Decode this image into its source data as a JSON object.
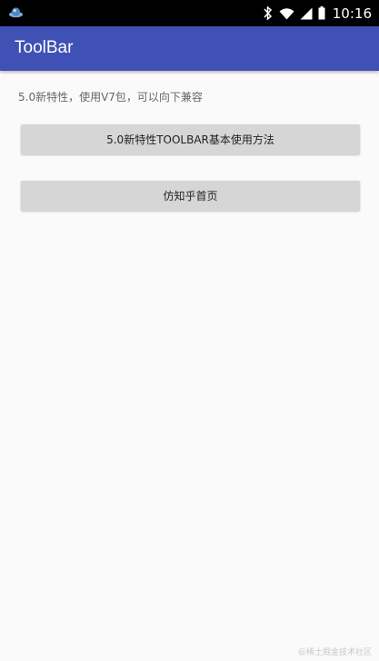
{
  "status_bar": {
    "time": "10:16",
    "icons": [
      "app-notification-icon",
      "bluetooth-icon",
      "wifi-icon",
      "signal-icon",
      "battery-icon"
    ]
  },
  "toolbar": {
    "title": "ToolBar",
    "color": "#3f51b5"
  },
  "content": {
    "intro": "5.0新特性，使用V7包，可以向下兼容",
    "buttons": [
      {
        "label": "5.0新特性TOOLBAR基本使用方法"
      },
      {
        "label": "仿知乎首页"
      }
    ]
  },
  "watermark": "@稀土掘金技术社区"
}
